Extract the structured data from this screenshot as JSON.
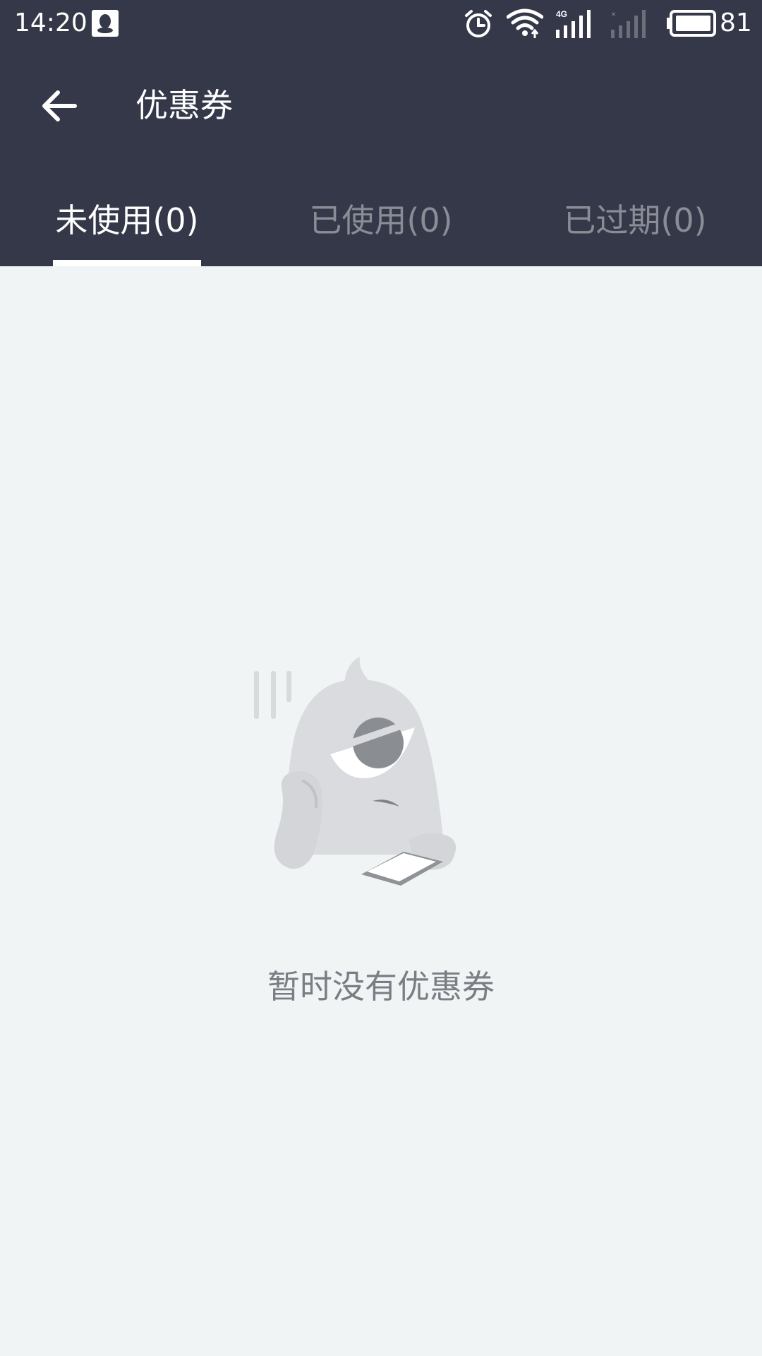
{
  "status_bar": {
    "time": "14:20",
    "battery": "81",
    "icons": [
      "qq-icon",
      "alarm-icon",
      "wifi-icon",
      "signal-4g-icon",
      "signal-no-sim-icon",
      "battery-icon"
    ]
  },
  "toolbar": {
    "title": "优惠券",
    "back_icon": "arrow-left-icon"
  },
  "tabs": [
    {
      "label": "未使用(0)",
      "active": true
    },
    {
      "label": "已使用(0)",
      "active": false
    },
    {
      "label": "已过期(0)",
      "active": false
    }
  ],
  "empty_state": {
    "message": "暂时没有优惠券",
    "illustration": "bored-monster-illustration"
  },
  "colors": {
    "header_bg": "#343849",
    "page_bg": "#f0f4f5",
    "tab_active": "#ffffff",
    "tab_inactive": "#8a8d96",
    "empty_text": "#7a7e84"
  }
}
